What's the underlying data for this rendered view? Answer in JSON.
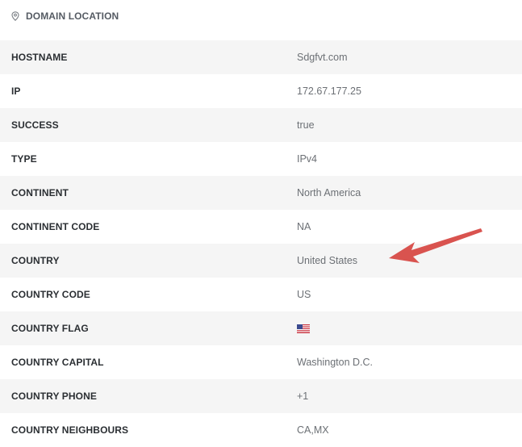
{
  "section": {
    "icon": "map-pin-icon",
    "title": "DOMAIN LOCATION"
  },
  "rows": [
    {
      "key": "HOSTNAME",
      "value": "Sdgfvt.com"
    },
    {
      "key": "IP",
      "value": "172.67.177.25"
    },
    {
      "key": "SUCCESS",
      "value": "true"
    },
    {
      "key": "TYPE",
      "value": "IPv4"
    },
    {
      "key": "CONTINENT",
      "value": "North America"
    },
    {
      "key": "CONTINENT CODE",
      "value": "NA"
    },
    {
      "key": "COUNTRY",
      "value": "United States"
    },
    {
      "key": "COUNTRY CODE",
      "value": "US"
    },
    {
      "key": "COUNTRY FLAG",
      "icon": "us-flag-icon"
    },
    {
      "key": "COUNTRY CAPITAL",
      "value": "Washington D.C."
    },
    {
      "key": "COUNTRY PHONE",
      "value": "+1"
    },
    {
      "key": "COUNTRY NEIGHBOURS",
      "value": "CA,MX"
    }
  ],
  "annotation": {
    "icon": "red-arrow-icon",
    "color": "#d9534f"
  },
  "colors": {
    "shaded_row": "#f5f5f5",
    "key_text": "#2b2f33",
    "value_text": "#6c7075"
  }
}
